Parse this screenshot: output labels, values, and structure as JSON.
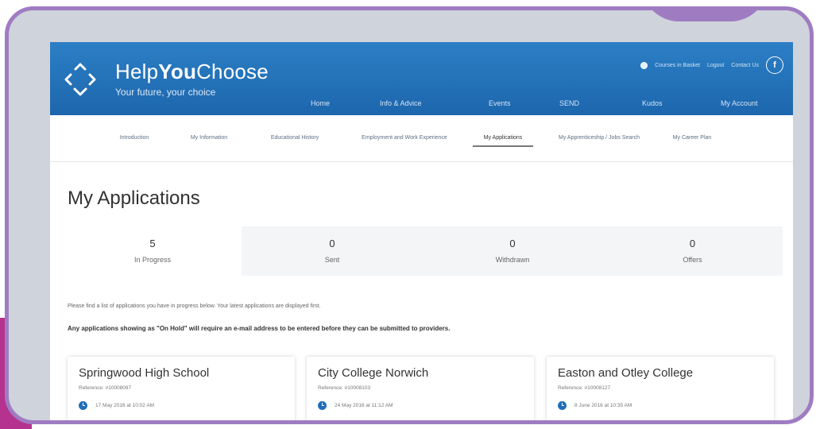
{
  "header": {
    "brand_prefix": "Help",
    "brand_bold": "You",
    "brand_suffix": "Choose",
    "tagline": "Your future, your choice",
    "util": {
      "basket": "Courses in Basket",
      "logout": "Logout",
      "contact": "Contact Us",
      "facebook": "f"
    },
    "nav": [
      "Home",
      "Info & Advice",
      "Events",
      "SEND",
      "Kudos",
      "My Account"
    ]
  },
  "subnav": {
    "items": [
      "Introduction",
      "My Information",
      "Educational History",
      "Employment and Work Experience",
      "My Applications",
      "My Apprenticeship / Jobs Search",
      "My Career Plan"
    ],
    "active": "My Applications"
  },
  "page": {
    "title": "My Applications",
    "stats": [
      {
        "count": "5",
        "label": "In Progress"
      },
      {
        "count": "0",
        "label": "Sent"
      },
      {
        "count": "0",
        "label": "Withdrawn"
      },
      {
        "count": "0",
        "label": "Offers"
      }
    ],
    "intro": "Please find a list of applications you have in progress below. Your latest applications are displayed first.",
    "warning": "Any applications showing as \"On Hold\" will require an e-mail address to be entered before they can be submitted to providers."
  },
  "cards": [
    {
      "name": "Springwood High School",
      "reference": "Reference: #10008097",
      "date": "17 May 2016 at 10:02 AM"
    },
    {
      "name": "City College Norwich",
      "reference": "Reference: #10008103",
      "date": "24 May 2016 at 11:12 AM"
    },
    {
      "name": "Easton and Otley College",
      "reference": "Reference: #10008127",
      "date": "8 June 2016 at 10:35 AM"
    }
  ],
  "colors": {
    "header_blue": "#1d66ad",
    "frame_purple": "#9f7cc2",
    "accent_magenta": "#b5338e",
    "clock_blue": "#1f6fb8"
  }
}
